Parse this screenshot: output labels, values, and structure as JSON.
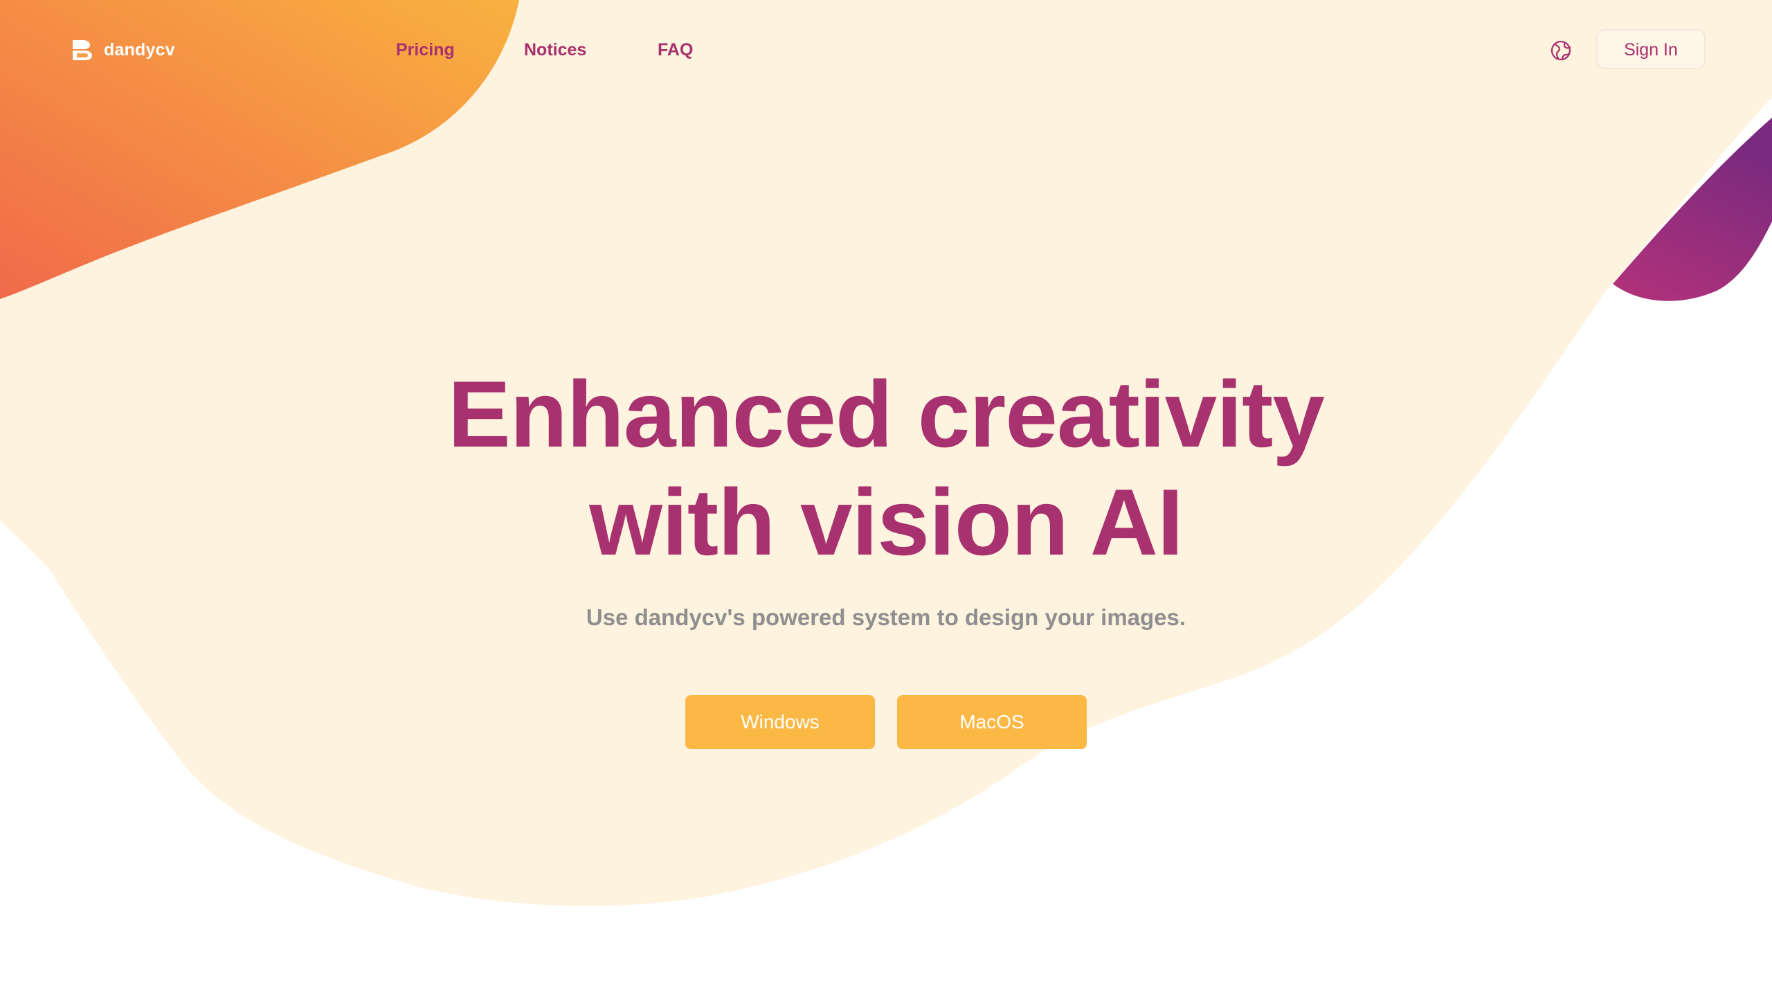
{
  "brand": {
    "name": "dandycv",
    "logo_icon": "dandycv-logo-icon"
  },
  "nav": {
    "items": [
      {
        "label": "Pricing"
      },
      {
        "label": "Notices"
      },
      {
        "label": "FAQ"
      }
    ],
    "language_icon": "globe-icon",
    "sign_in_label": "Sign In"
  },
  "hero": {
    "title_line1": "Enhanced creativity",
    "title_line2": "with vision AI",
    "subtitle": "Use dandycv's powered system to design your images.",
    "buttons": [
      {
        "label": "Windows"
      },
      {
        "label": "MacOS"
      }
    ]
  },
  "colors": {
    "brand_primary": "#A8316F",
    "accent_button": "#FBB844",
    "background_cream": "#FEF3DE",
    "subtitle_gray": "#8F8F8F",
    "blob_orange_start": "#F06A4A",
    "blob_orange_end": "#F9B23F",
    "blob_purple_start": "#B3327A",
    "blob_purple_end": "#7A2A7F"
  }
}
